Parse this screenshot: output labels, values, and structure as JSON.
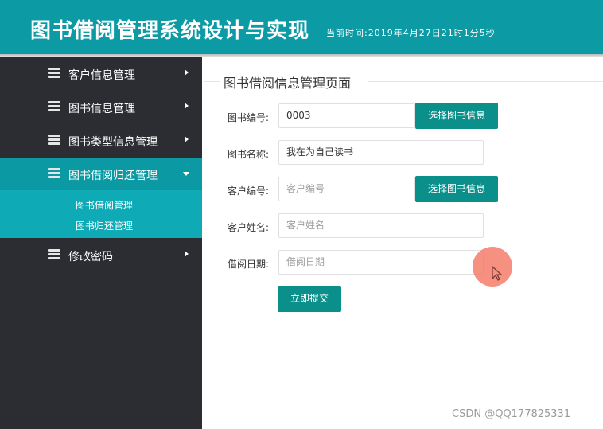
{
  "header": {
    "title": "图书借阅管理系统设计与实现",
    "time_text": "当前时间:2019年4月27日21时1分5秒"
  },
  "sidebar": {
    "items": [
      {
        "label": "客户信息管理",
        "icon": "stack-icon"
      },
      {
        "label": "图书信息管理",
        "icon": "stack-icon"
      },
      {
        "label": "图书类型信息管理",
        "icon": "stack-icon"
      },
      {
        "label": "图书借阅归还管理",
        "icon": "stack-icon",
        "active": true,
        "subitems": [
          {
            "label": "图书借阅管理"
          },
          {
            "label": "图书归还管理"
          }
        ]
      },
      {
        "label": "修改密码",
        "icon": "stack-icon"
      }
    ]
  },
  "main": {
    "page_title": "图书借阅信息管理页面",
    "form": {
      "book_id": {
        "label": "图书编号:",
        "value": "0003"
      },
      "book_name": {
        "label": "图书名称:",
        "value": "我在为自己读书"
      },
      "customer_id": {
        "label": "客户编号:",
        "placeholder": "客户编号"
      },
      "customer_name": {
        "label": "客户姓名:",
        "placeholder": "客户姓名"
      },
      "borrow_date": {
        "label": "借阅日期:",
        "placeholder": "借阅日期"
      },
      "select_book_button": "选择图书信息",
      "select_customer_button": "选择图书信息",
      "submit_button": "立即提交"
    }
  },
  "watermark": "CSDN @QQ177825331",
  "colors": {
    "header": "#0c9aa5",
    "sidebar": "#2b2d33",
    "active_menu": "#0b9aa4",
    "submenu": "#0eaab6",
    "button": "#0b8f8a",
    "cursor_highlight": "#f47864"
  }
}
